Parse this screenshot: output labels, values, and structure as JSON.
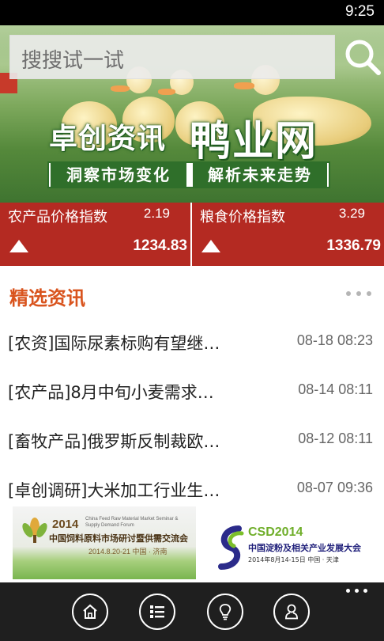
{
  "statusbar": {
    "time": "9:25"
  },
  "search": {
    "placeholder": "搜搜试一试"
  },
  "banner": {
    "title_left": "卓创资讯",
    "title_right": "鸭业网",
    "slogan_left": "洞察市场变化",
    "slogan_right": "解析未来走势"
  },
  "indices": [
    {
      "name": "农产品价格指数",
      "change": "2.19",
      "value": "1234.83",
      "direction": "up"
    },
    {
      "name": "粮食价格指数",
      "change": "3.29",
      "value": "1336.79",
      "direction": "up"
    }
  ],
  "featured": {
    "title": "精选资讯",
    "items": [
      {
        "title": "[农资]国际尿素标购有望继…",
        "time": "08-18 08:23"
      },
      {
        "title": "[农产品]8月中旬小麦需求…",
        "time": "08-14 08:11"
      },
      {
        "title": "[畜牧产品]俄罗斯反制裁欧…",
        "time": "08-12 08:11"
      },
      {
        "title": "[卓创调研]大米加工行业生…",
        "time": "08-07 09:36"
      }
    ]
  },
  "ads": [
    {
      "year": "2014",
      "subtitle": "China Feed Raw Material Market Seminar & Supply Demand Forum",
      "name": "中国饲料原料市场研讨暨供需交流会",
      "date": "2014.8.20-21  中国 · 济南"
    },
    {
      "year": "CSD2014",
      "name": "中国淀粉及相关产业发展大会",
      "date": "2014年8月14-15日    中国 · 天津"
    }
  ],
  "appbar": {
    "buttons": [
      "home-icon",
      "list-icon",
      "lightbulb-icon",
      "user-icon"
    ]
  },
  "colors": {
    "accent_red": "#b42a22",
    "section_title": "#d9541e",
    "appbar_bg": "#1f1f1f",
    "banner_green": "#2f6f2a"
  }
}
